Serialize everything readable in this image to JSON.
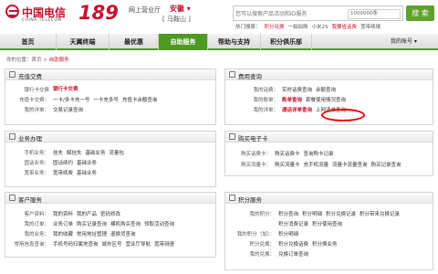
{
  "brand": {
    "cn": "中国电信",
    "en": "CHINA TELECOM",
    "num": "189",
    "site": "网上营业厅",
    "province": "安徽",
    "province_caret": "▾",
    "city": "[ 马鞍山 ]"
  },
  "search": {
    "placeholder": "您可以搜索产品活动和ID服务",
    "select": "1000000条",
    "button": "搜 索"
  },
  "hot": {
    "label": "热门搜索：",
    "items": [
      "积分兑换",
      "一拍拍购",
      "小米2S",
      "我要省话费",
      "宽带续报"
    ]
  },
  "nav": {
    "items": [
      "首页",
      "天翼终端",
      "最优惠",
      "自助服务",
      "帮助与支持",
      "积分俱乐部"
    ],
    "account": "我的账号 ▾"
  },
  "breadcrumb": {
    "prefix": "你的位置：首页",
    "sep": " > ",
    "current": "自助服务"
  },
  "panels": {
    "recharge": {
      "title": "充值交费",
      "rows": [
        {
          "label": "银行卡交费",
          "links": [
            "银行卡交费"
          ]
        },
        {
          "label": "充值卡交费：",
          "links": [
            "一卡/多卡充一号",
            "一卡充多号",
            "充值卡余额查询"
          ]
        },
        {
          "label": "我的详单：",
          "links": [
            "交易记录查询"
          ]
        }
      ]
    },
    "fees": {
      "title": "费用查询",
      "rows": [
        {
          "label": "我的话费：",
          "links": [
            "实时话费查询",
            "余额查询"
          ]
        },
        {
          "label": "我的账单：",
          "links": [
            "账单查询",
            "套餐使用情况查询"
          ]
        },
        {
          "label": "我的详单：",
          "links": [
            "通话详单查询",
            "上网清单查询"
          ]
        }
      ]
    },
    "business": {
      "title": "业务办理",
      "rows": [
        {
          "label": "手机业务：",
          "links": [
            "挂失",
            "解挂失",
            "基础业务",
            "流量包"
          ]
        },
        {
          "label": "固话业务：",
          "links": [
            "固话续约",
            "基础业务"
          ]
        },
        {
          "label": "宽带业务：",
          "links": [
            "宽带续费",
            "基础业务"
          ]
        }
      ]
    },
    "ebill": {
      "title": "购买电子卡",
      "rows": [
        {
          "label": "购买话费卡：",
          "links": [
            "购买话费卡",
            "查询购卡记录"
          ]
        },
        {
          "label": "购买流量卡：",
          "links": [
            "购买流量卡",
            "充手机流量",
            "流量卡流量查询",
            "购买记录查询"
          ]
        }
      ]
    },
    "customer": {
      "title": "客户服务",
      "rows": [
        {
          "label": "客户资料：",
          "links": [
            "我的资料",
            "我的产品",
            "密码修改"
          ]
        },
        {
          "label": "我的订单：",
          "links": [
            "业务订单",
            "购买记录查询",
            "裸机购买查询",
            "领取活动查询"
          ]
        },
        {
          "label": "我的业务：",
          "links": [
            "我的收藏",
            "常用地址管理",
            "退换货查询"
          ]
        },
        {
          "label": "常用信息查询：",
          "links": [
            "手机号码归属地查询",
            "城市区号",
            "营业厅导航",
            "宽带测速"
          ]
        }
      ]
    },
    "points": {
      "title": "积分服务",
      "rows": [
        {
          "label": "我的积分：",
          "links": [
            "积分查询",
            "积分明细",
            "积分兑换记录",
            "积分带来兑换记录"
          ]
        },
        {
          "label": "",
          "links": [
            "积分消费记录",
            "积分使用查询"
          ]
        },
        {
          "label": "我的积分（加）：",
          "links": [
            "积分明细"
          ]
        },
        {
          "label": "积分兑换：",
          "links": [
            "积分兑换话费",
            "积分换业务"
          ]
        },
        {
          "label": "我的兑换：",
          "links": [
            "兑换订单查询"
          ]
        }
      ]
    }
  }
}
